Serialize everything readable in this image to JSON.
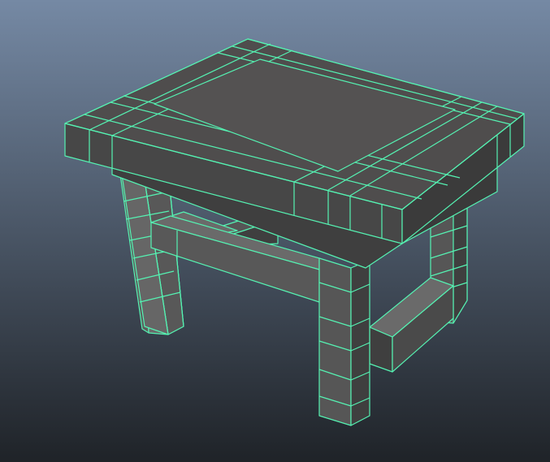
{
  "viewport": {
    "background_top": "#7589a4",
    "background_bottom": "#1f2328",
    "wireframe_color": "#55f2b2",
    "face_colors": {
      "light": "#6a6a6a",
      "mid": "#565656",
      "dark": "#3f3f3f",
      "top": "#4f4d4d"
    }
  },
  "scene": {
    "object": "table-mesh",
    "shading": "smooth-shade-with-wireframe-on-shaded"
  }
}
